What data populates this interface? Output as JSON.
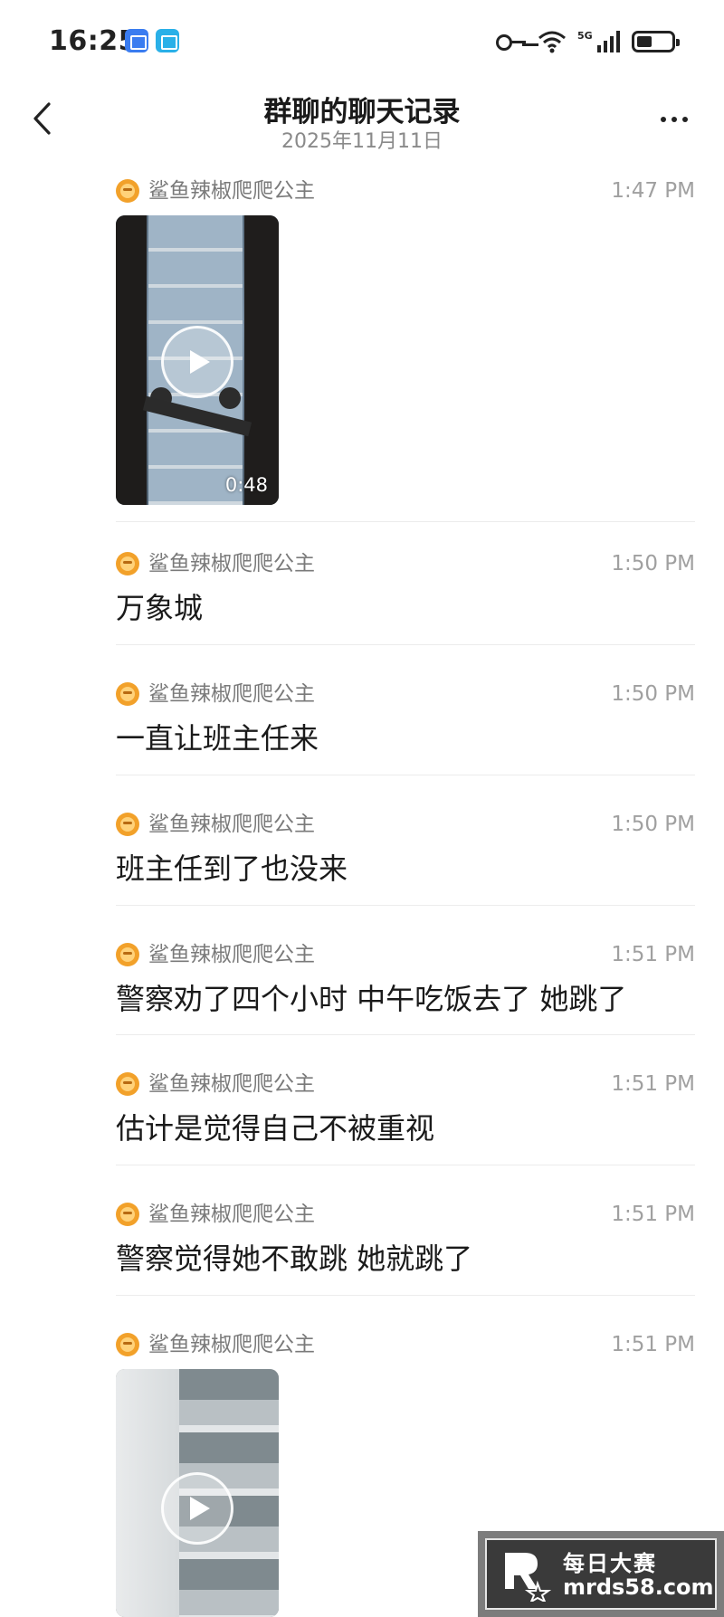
{
  "status_bar": {
    "time": "16:25",
    "icons": [
      "notification-app-icon",
      "reader-app-icon",
      "key-icon",
      "wifi-icon",
      "5g-signal-icon",
      "battery-icon"
    ],
    "network_label": "5G"
  },
  "header": {
    "title": "群聊的聊天记录",
    "subtitle": "2025年11月11日"
  },
  "messages": [
    {
      "sender": "鲨鱼辣椒爬爬公主",
      "time": "1:47 PM",
      "type": "video",
      "duration": "0:48"
    },
    {
      "sender": "鲨鱼辣椒爬爬公主",
      "time": "1:50 PM",
      "type": "text",
      "text": "万象城"
    },
    {
      "sender": "鲨鱼辣椒爬爬公主",
      "time": "1:50 PM",
      "type": "text",
      "text": "一直让班主任来"
    },
    {
      "sender": "鲨鱼辣椒爬爬公主",
      "time": "1:50 PM",
      "type": "text",
      "text": "班主任到了也没来"
    },
    {
      "sender": "鲨鱼辣椒爬爬公主",
      "time": "1:51 PM",
      "type": "text",
      "text": "警察劝了四个小时 中午吃饭去了 她跳了"
    },
    {
      "sender": "鲨鱼辣椒爬爬公主",
      "time": "1:51 PM",
      "type": "text",
      "text": "估计是觉得自己不被重视"
    },
    {
      "sender": "鲨鱼辣椒爬爬公主",
      "time": "1:51 PM",
      "type": "text",
      "text": "警察觉得她不敢跳 她就跳了"
    },
    {
      "sender": "鲨鱼辣椒爬爬公主",
      "time": "1:51 PM",
      "type": "video",
      "duration": ""
    }
  ],
  "watermark": {
    "cn": "每日大赛",
    "url": "mrds58.com"
  }
}
